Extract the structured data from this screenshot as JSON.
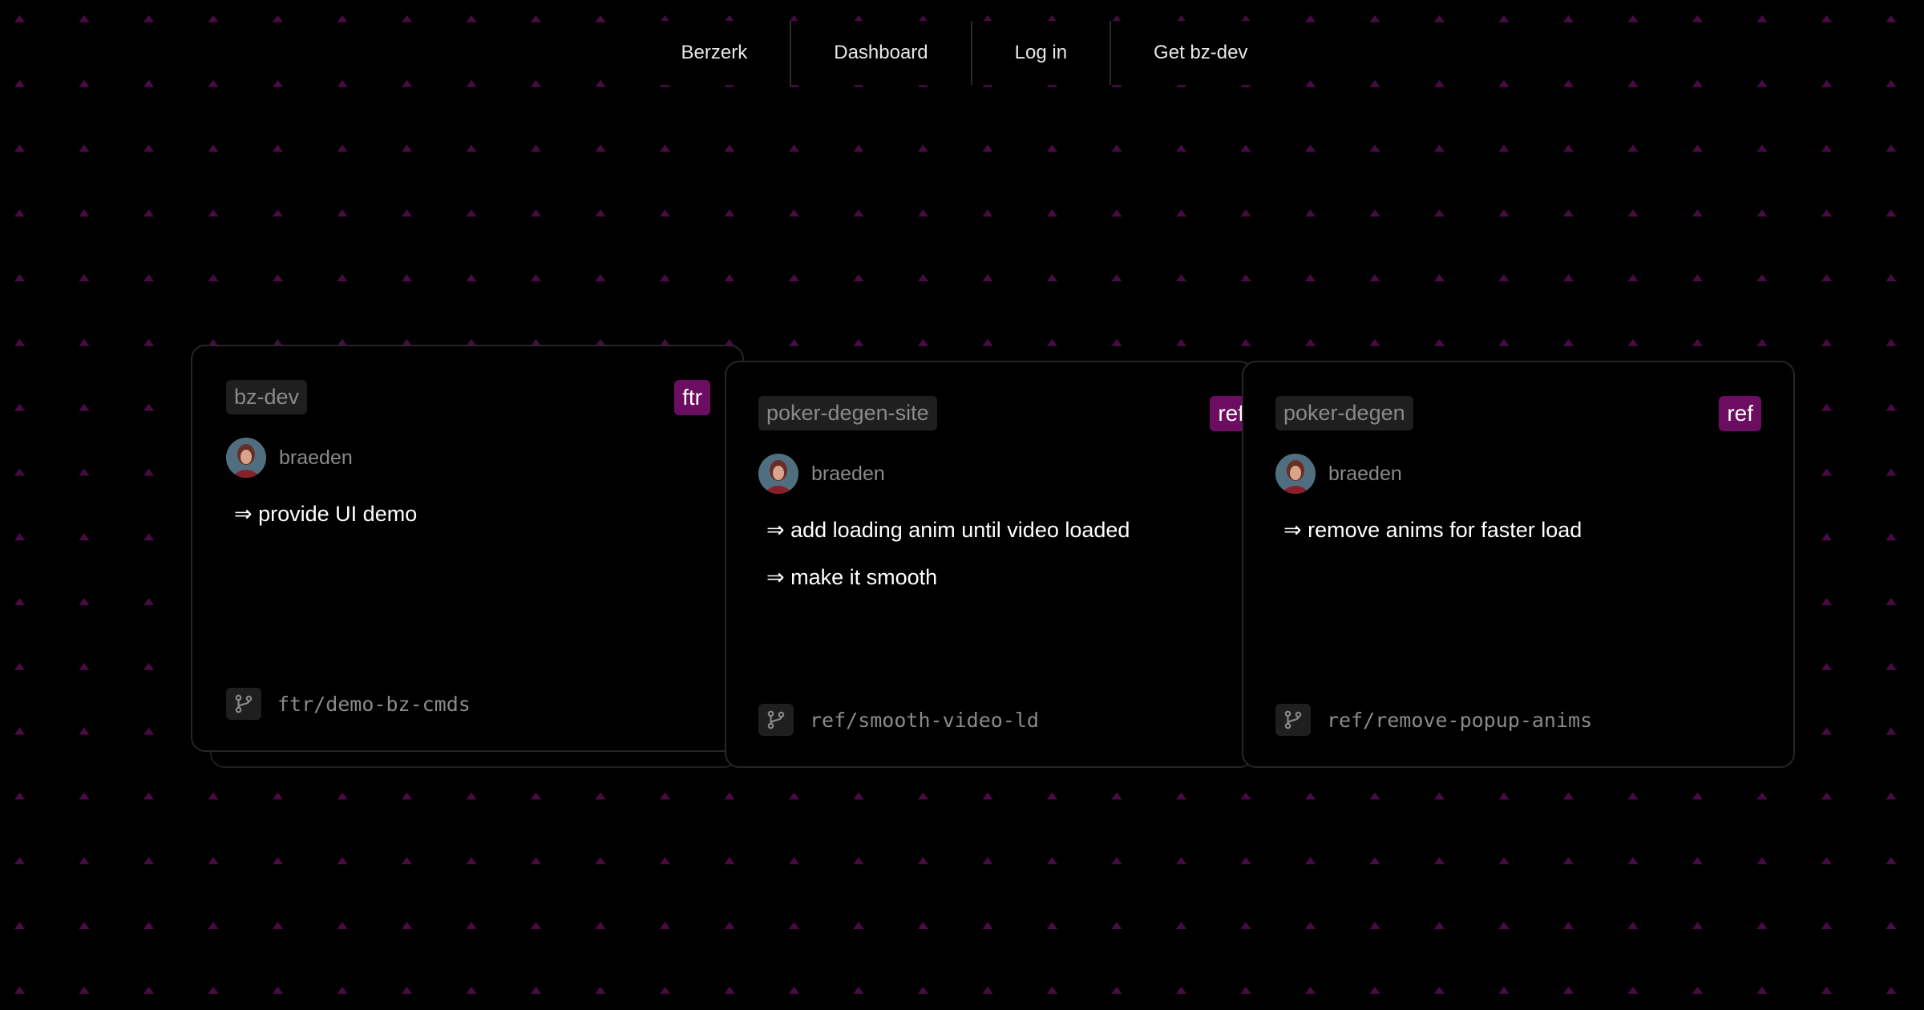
{
  "nav": {
    "items": [
      {
        "label": "Berzerk"
      },
      {
        "label": "Dashboard"
      },
      {
        "label": "Log in"
      },
      {
        "label": "Get bz-dev"
      }
    ]
  },
  "colors": {
    "background": "#000000",
    "accent": "#6b0d60",
    "diamond": "#4a0a45",
    "chip_bg": "#1f1f1f",
    "muted_text": "#8a8a8a"
  },
  "cards": [
    {
      "repo": "bz-dev",
      "type": "ftr",
      "author": "braeden",
      "tasks": [
        "⇒ provide UI demo"
      ],
      "branch_icon": "git-branch-icon",
      "branch": "ftr/demo-bz-cmds"
    },
    {
      "repo": "poker-degen-site",
      "type": "ref",
      "author": "braeden",
      "tasks": [
        "⇒ add loading anim until video loaded",
        "⇒ make it smooth"
      ],
      "branch_icon": "git-branch-icon",
      "branch": "ref/smooth-video-ld"
    },
    {
      "repo": "poker-degen",
      "type": "ref",
      "author": "braeden",
      "tasks": [
        "⇒ remove anims for faster load"
      ],
      "branch_icon": "git-branch-icon",
      "branch": "ref/remove-popup-anims"
    }
  ]
}
